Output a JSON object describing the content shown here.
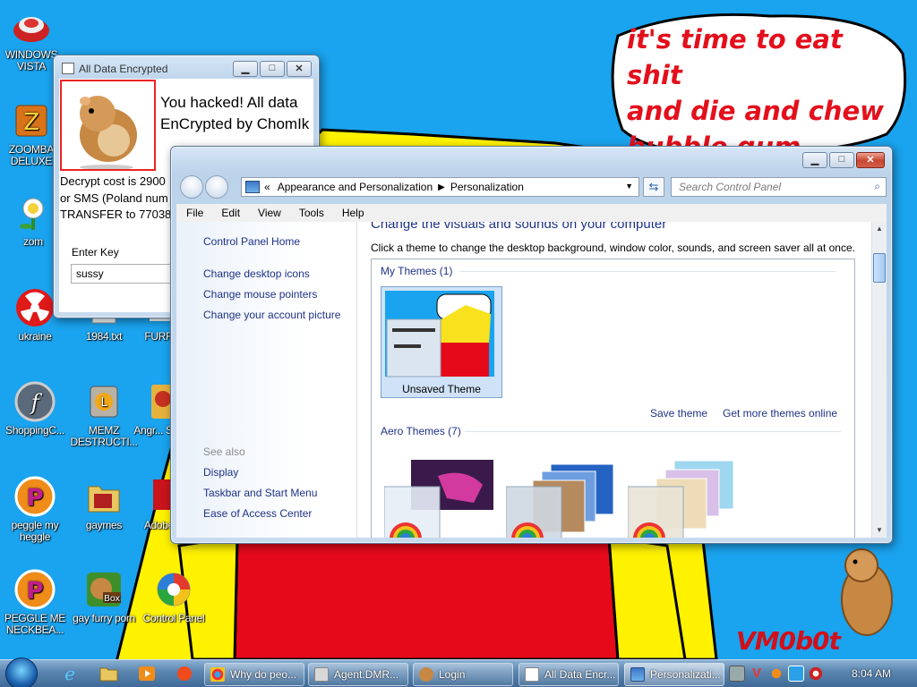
{
  "colors": {
    "desktop": "#1aa3ee",
    "speech_text": "#e3101c",
    "link": "#1e3287"
  },
  "wallpaper": {
    "speech_lines": [
      "it's time to eat shit",
      "and die and chew",
      "bubble gum"
    ],
    "signature": "VM0b0t"
  },
  "desktop_icons": [
    {
      "label": "WINDOWS VISTA",
      "icon": "red-disc-icon"
    },
    {
      "label": "ZOOMBA DELUXE",
      "icon": "zuma-frog-icon"
    },
    {
      "label": "zom",
      "icon": "plant-icon"
    },
    {
      "label": "ukraine",
      "icon": "radiation-icon"
    },
    {
      "label": "ShoppingC...",
      "icon": "flash-icon"
    },
    {
      "label": "peggle my heggle",
      "icon": "peggle-icon"
    },
    {
      "label": "PEGGLE ME NECKBEA...",
      "icon": "peggle-icon"
    },
    {
      "label": "1984.txt",
      "icon": "text-file-icon"
    },
    {
      "label": "MEMZ DESTRUCTI...",
      "icon": "memz-icon"
    },
    {
      "label": "gaymes",
      "icon": "folder-icon"
    },
    {
      "label": "gay furry porn",
      "icon": "hamster-box-icon"
    },
    {
      "label": "FURR...",
      "icon": "furry-icon"
    },
    {
      "label": "Angr... Sea...",
      "icon": "angry-birds-icon"
    },
    {
      "label": "Adobe...",
      "icon": "adobe-icon"
    },
    {
      "label": "Control Panel",
      "icon": "control-panel-icon"
    }
  ],
  "encrypt_window": {
    "title": "All Data Encrypted",
    "headline_1": "You hacked! All data",
    "headline_2": "EnCrypted by ChomIk",
    "cost_1": "Decrypt cost is 2900",
    "cost_2": "or SMS (Poland num",
    "cost_3": "TRANSFER to 77038",
    "key_label": "Enter Key",
    "key_value": "sussy"
  },
  "personalization_window": {
    "breadcrumb": [
      "Appearance and Personalization",
      "Personalization"
    ],
    "search_placeholder": "Search Control Panel",
    "menu": [
      "File",
      "Edit",
      "View",
      "Tools",
      "Help"
    ],
    "left_links": [
      "Control Panel Home",
      "Change desktop icons",
      "Change mouse pointers",
      "Change your account picture"
    ],
    "see_also_label": "See also",
    "see_also": [
      "Display",
      "Taskbar and Start Menu",
      "Ease of Access Center"
    ],
    "heading": "Change the visuals and sounds on your computer",
    "subheading": "Click a theme to change the desktop background, window color, sounds, and screen saver all at once.",
    "my_themes_label": "My Themes (1)",
    "unsaved_theme_label": "Unsaved Theme",
    "save_theme": "Save theme",
    "get_more_themes": "Get more themes online",
    "aero_themes_label": "Aero Themes (7)"
  },
  "taskbar": {
    "tasks": [
      "Why do peo...",
      "Agent.DMR...",
      "Login",
      "All Data Encr...",
      "Personalizati..."
    ],
    "clock": "8:04 AM"
  }
}
